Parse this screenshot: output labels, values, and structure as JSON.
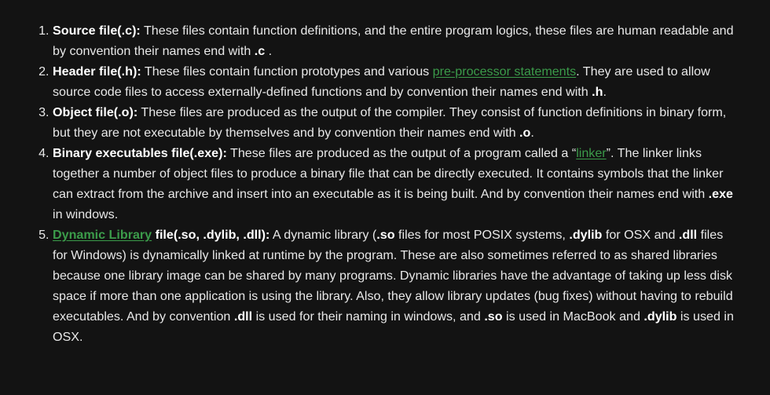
{
  "items": [
    {
      "title": "Source file(.c):",
      "text": " These files contain function definitions, and the entire program logics, these files are human readable and by convention their names end with ",
      "ext": ".c",
      "end": " ."
    },
    {
      "title": "Header file(.h):",
      "pre": " These files contain function prototypes and various ",
      "link": "pre-processor statements",
      "post": ". They are used to allow source code files to access externally-defined functions and by convention their names end with ",
      "ext": ".h",
      "end": "."
    },
    {
      "title": "Object file(.o):",
      "text": " These files are produced as the output of the compiler. They consist of function definitions in binary form, but they are not executable by themselves and by convention their names end with ",
      "ext": ".o",
      "end": "."
    },
    {
      "title": "Binary executables file(.exe):",
      "pre": " These files are produced as the output of a program called a “",
      "link": "linker",
      "post": "”. The linker links together a number of object files to produce a binary file that can be directly executed. It contains symbols that the linker can extract from the archive and insert into an executable as it is being built. And by convention their names end with ",
      "ext": ".exe",
      "end": " in windows."
    },
    {
      "link": "Dynamic Library",
      "title": " file(.so, .dylib, .dll):",
      "t1": " A dynamic library (",
      "e1": ".so",
      "t2": " files for most POSIX systems, ",
      "e2": ".dylib",
      "t3": " for OSX and ",
      "e3": ".dll",
      "t4": " files for Windows) is dynamically linked at runtime by the program. These are also sometimes referred to as shared libraries because one library image can be shared by many programs. Dynamic libraries have the advantage of taking up less disk space if more than one application is using the library. Also, they allow library updates (bug fixes) without having to rebuild executables. And by convention ",
      "e4": ".dll",
      "t5": " is used for their naming in windows, and ",
      "e5": ".so",
      "t6": " is used in MacBook and ",
      "e6": ".dylib",
      "t7": " is used in OSX."
    }
  ]
}
